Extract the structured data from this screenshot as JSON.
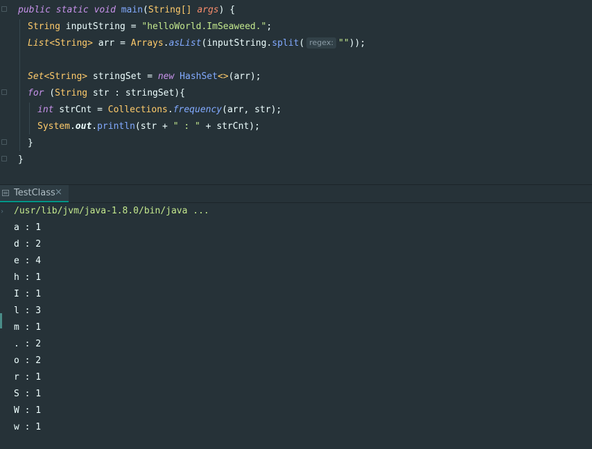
{
  "editor": {
    "sig": {
      "public": "public",
      "static": "static",
      "void": "void",
      "main": "main",
      "open": "(",
      "string_arr": "String[]",
      "args": "args",
      "close": ") {"
    },
    "l2": {
      "type": "String",
      "rest": " inputString = ",
      "str": "\"helloWorld.ImSeaweed.\"",
      "end": ";"
    },
    "l3": {
      "list": "List",
      "generic": "<String>",
      "mid": " arr = ",
      "arrays": "Arrays",
      "dot": ".",
      "aslist": "asList",
      "arg": "(inputString.",
      "split": "split",
      "paren": "(",
      "hint": "regex:",
      "str": "\"\"",
      "end": "));"
    },
    "l5": {
      "set": "Set",
      "generic": "<String>",
      "mid": " stringSet = ",
      "new": "new",
      "sp": " ",
      "hashset": "HashSet",
      "diamond": "<>",
      "end": "(arr);"
    },
    "l6": {
      "for": "for",
      "open": " (",
      "string": "String",
      "rest": " str : stringSet){"
    },
    "l7": {
      "int": "int",
      "mid": " strCnt = ",
      "coll": "Collections",
      "dot": ".",
      "freq": "frequency",
      "end": "(arr, str);"
    },
    "l8": {
      "system": "System",
      "dot1": ".",
      "out": "out",
      "dot2": ".",
      "println": "println",
      "p1": "(str + ",
      "str": "\" : \"",
      "p2": " + strCnt);"
    },
    "l9": "}",
    "l10": "}"
  },
  "run_panel": {
    "tab_label": "TestClass",
    "close_glyph": "×",
    "command": "/usr/lib/jvm/java-1.8.0/bin/java ...",
    "output": [
      "a : 1",
      "d : 2",
      "e : 4",
      "h : 1",
      "I : 1",
      "l : 3",
      "m : 1",
      ". : 2",
      "o : 2",
      "r : 1",
      "S : 1",
      "W : 1",
      "w : 1"
    ]
  },
  "colors": {
    "background": "#263238",
    "keyword": "#c792ea",
    "type": "#ffcb6b",
    "string": "#c3e88d",
    "function": "#82aaff",
    "parameter": "#f78c6c",
    "accent": "#009688"
  },
  "icons": {
    "tab_icon": "console-icon",
    "close": "close-icon",
    "fold": "fold-marker-icon"
  }
}
